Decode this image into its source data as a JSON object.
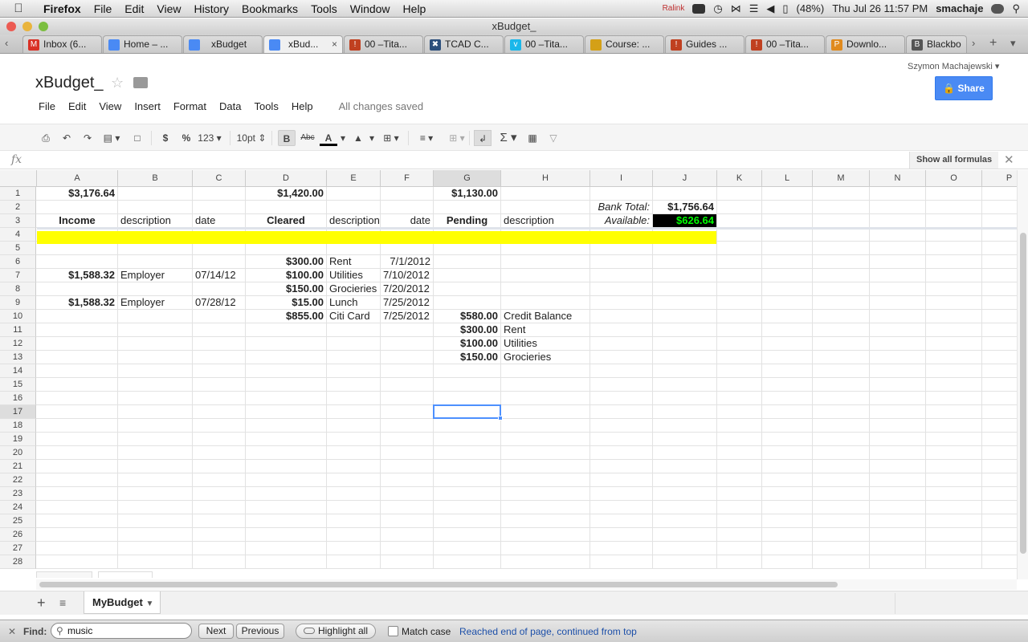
{
  "menubar": {
    "app": "Firefox",
    "items": [
      "File",
      "Edit",
      "View",
      "History",
      "Bookmarks",
      "Tools",
      "Window",
      "Help"
    ],
    "ralink": "Ralink",
    "battery": "(48%)",
    "clock": "Thu Jul 26  11:57 PM",
    "user": "smachaje"
  },
  "window": {
    "title": "xBudget_"
  },
  "tabs": [
    {
      "label": "Inbox (6...",
      "favicon": "gmail-icon",
      "color": "#d93025"
    },
    {
      "label": "Home – ...",
      "favicon": "docs-icon",
      "color": "#4a8af4"
    },
    {
      "label": "xBudget",
      "favicon": "docs-icon",
      "color": "#4a8af4"
    },
    {
      "label": "xBud...",
      "favicon": "docs-icon",
      "color": "#4a8af4",
      "active": true
    },
    {
      "label": "00 –Tita...",
      "favicon": "warning-icon",
      "color": "#c04020"
    },
    {
      "label": "TCAD C...",
      "favicon": "tcad-icon",
      "color": "#2c4f7c"
    },
    {
      "label": "00 –Tita...",
      "favicon": "vimeo-icon",
      "color": "#1ab7ea"
    },
    {
      "label": "Course: ...",
      "favicon": "course-icon",
      "color": "#d4a017"
    },
    {
      "label": "Guides ...",
      "favicon": "warning-icon",
      "color": "#c04020"
    },
    {
      "label": "00 –Tita...",
      "favicon": "warning-icon",
      "color": "#c04020"
    },
    {
      "label": "Downlo...",
      "favicon": "download-icon",
      "color": "#e08a1e"
    },
    {
      "label": "Blackbo",
      "favicon": "blackboard-icon",
      "color": "#555555"
    }
  ],
  "doc": {
    "title": "xBudget_",
    "user": "Szymon Machajewski",
    "share": "Share",
    "menu": [
      "File",
      "Edit",
      "View",
      "Insert",
      "Format",
      "Data",
      "Tools",
      "Help"
    ],
    "saved": "All changes saved"
  },
  "toolbar": {
    "currency": "$",
    "percent": "%",
    "number": "123",
    "fontsize": "10pt",
    "bold": "B",
    "strike": "Abc",
    "textcolor": "A",
    "sigma": "Σ"
  },
  "formulabar": {
    "fx": "fx",
    "show_all": "Show all formulas"
  },
  "columns": [
    "A",
    "B",
    "C",
    "D",
    "E",
    "F",
    "G",
    "H",
    "I",
    "J",
    "K",
    "L",
    "M",
    "N",
    "O",
    "P"
  ],
  "rows": [
    "1",
    "2",
    "3",
    "4",
    "5",
    "6",
    "7",
    "8",
    "9",
    "10",
    "11",
    "12",
    "13",
    "14",
    "15",
    "16",
    "17",
    "18",
    "19",
    "20",
    "21",
    "22",
    "23",
    "24",
    "25",
    "26",
    "27",
    "28"
  ],
  "cells": {
    "A1": "$3,176.64",
    "D1": "$1,420.00",
    "G1": "$1,130.00",
    "I2": "Bank Total:",
    "J2": "$1,756.64",
    "A3": "Income",
    "B3": "description",
    "C3": "date",
    "D3": "Cleared",
    "E3": "description",
    "F3": "date",
    "G3": "Pending",
    "H3": "description",
    "I3": "Available:",
    "J3": "$626.64",
    "D6": "$300.00",
    "E6": "Rent",
    "F6": "7/1/2012",
    "A7": "$1,588.32",
    "B7": "Employer",
    "C7": "07/14/12",
    "D7": "$100.00",
    "E7": "Utilities",
    "F7": "7/10/2012",
    "D8": "$150.00",
    "E8": "Grocieries",
    "F8": "7/20/2012",
    "A9": "$1,588.32",
    "B9": "Employer",
    "C9": "07/28/12",
    "D9": "$15.00",
    "E9": "Lunch",
    "F9": "7/25/2012",
    "D10": "$855.00",
    "E10": "Citi Card",
    "F10": "7/25/2012",
    "G10": "$580.00",
    "H10": "Credit Balance",
    "G11": "$300.00",
    "H11": "Rent",
    "G12": "$100.00",
    "H12": "Utilities",
    "G13": "$150.00",
    "H13": "Grocieries"
  },
  "selected_cell": "G17",
  "sheet": {
    "name": "MyBudget"
  },
  "findbar": {
    "label": "Find:",
    "query": "music",
    "next": "Next",
    "previous": "Previous",
    "highlight": "Highlight all",
    "matchcase": "Match case",
    "status": "Reached end of page, continued from top"
  },
  "colors": {
    "accent": "#4a8af4",
    "highlight_row": "#ffff00",
    "available_fg": "#00ff00"
  }
}
